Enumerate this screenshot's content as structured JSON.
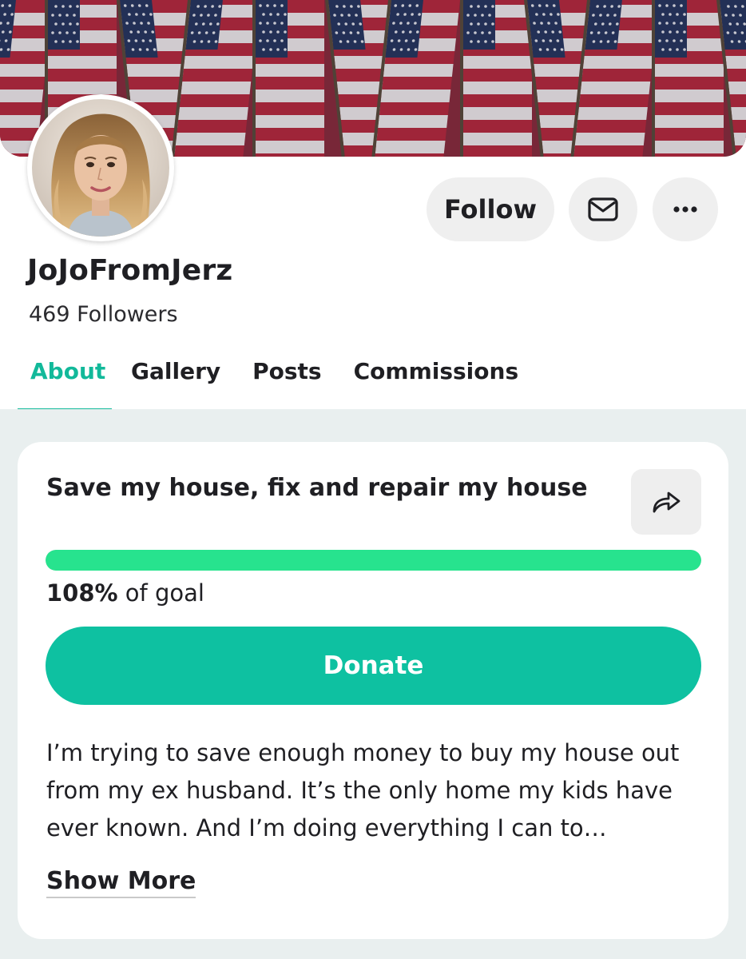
{
  "profile": {
    "username": "JoJoFromJerz",
    "followers": "469 Followers",
    "banner_image": "american-flags-banner",
    "avatar_image": "woman-with-wavy-blonde-hair"
  },
  "actions": {
    "follow_label": "Follow",
    "message_icon": "mail-icon",
    "more_icon": "more-dots-icon"
  },
  "tabs": [
    {
      "label": "About",
      "active": true
    },
    {
      "label": "Gallery",
      "active": false
    },
    {
      "label": "Posts",
      "active": false
    },
    {
      "label": "Commissions",
      "active": false
    }
  ],
  "campaign": {
    "title": "Save my house, fix and repair my house",
    "share_icon": "share-arrow-icon",
    "progress_fraction": 1.0,
    "percent_label": "108%",
    "goal_suffix": " of goal",
    "donate_label": "Donate",
    "description": "I’m trying to save enough money to buy my house out from my ex husband. It’s the only home my kids have ever known. And I’m doing everything I can to…",
    "show_more_label": "Show More"
  },
  "colors": {
    "accent": "#12b99a",
    "donate_button": "#0ec1a1",
    "progress_fill": "#27e38e",
    "section_background": "#e9efef"
  }
}
